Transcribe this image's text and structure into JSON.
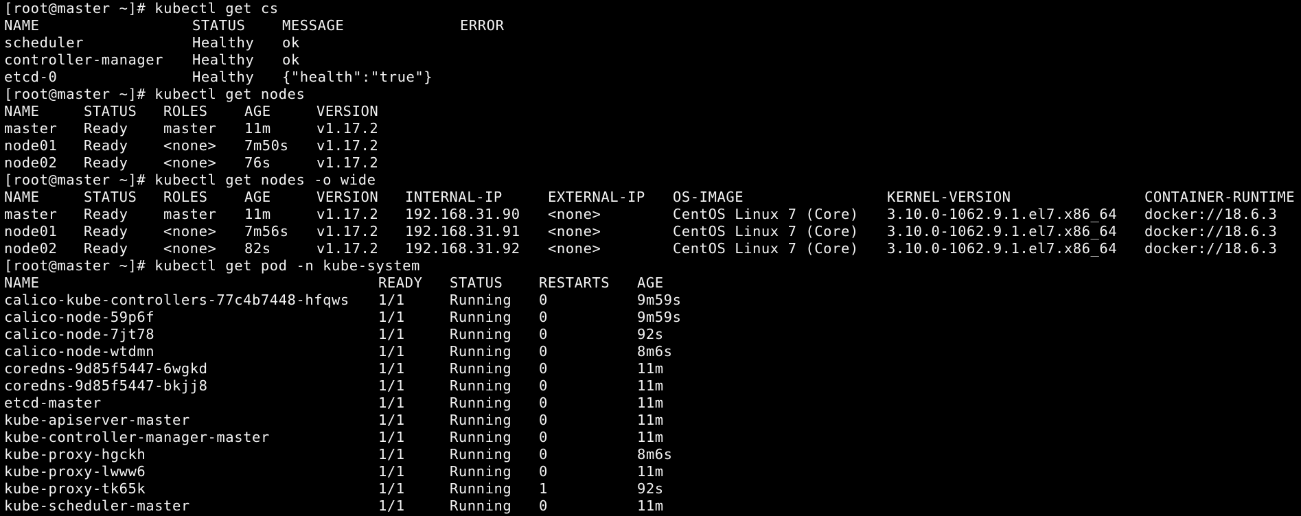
{
  "terminal": {
    "prompt": "[root@master ~]# ",
    "sections": [
      {
        "command": "kubectl get cs",
        "headers": [
          "NAME",
          "STATUS",
          "MESSAGE",
          "ERROR"
        ],
        "rows": [
          [
            "scheduler",
            "Healthy",
            "ok",
            ""
          ],
          [
            "controller-manager",
            "Healthy",
            "ok",
            ""
          ],
          [
            "etcd-0",
            "Healthy",
            "{\"health\":\"true\"}",
            ""
          ]
        ]
      },
      {
        "command": "kubectl get nodes",
        "headers": [
          "NAME",
          "STATUS",
          "ROLES",
          "AGE",
          "VERSION"
        ],
        "rows": [
          [
            "master",
            "Ready",
            "master",
            "11m",
            "v1.17.2"
          ],
          [
            "node01",
            "Ready",
            "<none>",
            "7m50s",
            "v1.17.2"
          ],
          [
            "node02",
            "Ready",
            "<none>",
            "76s",
            "v1.17.2"
          ]
        ]
      },
      {
        "command": "kubectl get nodes -o wide",
        "headers": [
          "NAME",
          "STATUS",
          "ROLES",
          "AGE",
          "VERSION",
          "INTERNAL-IP",
          "EXTERNAL-IP",
          "OS-IMAGE",
          "KERNEL-VERSION",
          "CONTAINER-RUNTIME"
        ],
        "rows": [
          [
            "master",
            "Ready",
            "master",
            "11m",
            "v1.17.2",
            "192.168.31.90",
            "<none>",
            "CentOS Linux 7 (Core)",
            "3.10.0-1062.9.1.el7.x86_64",
            "docker://18.6.3"
          ],
          [
            "node01",
            "Ready",
            "<none>",
            "7m56s",
            "v1.17.2",
            "192.168.31.91",
            "<none>",
            "CentOS Linux 7 (Core)",
            "3.10.0-1062.9.1.el7.x86_64",
            "docker://18.6.3"
          ],
          [
            "node02",
            "Ready",
            "<none>",
            "82s",
            "v1.17.2",
            "192.168.31.92",
            "<none>",
            "CentOS Linux 7 (Core)",
            "3.10.0-1062.9.1.el7.x86_64",
            "docker://18.6.3"
          ]
        ]
      },
      {
        "command": "kubectl get pod -n kube-system",
        "headers": [
          "NAME",
          "READY",
          "STATUS",
          "RESTARTS",
          "AGE"
        ],
        "rows": [
          [
            "calico-kube-controllers-77c4b7448-hfqws",
            "1/1",
            "Running",
            "0",
            "9m59s"
          ],
          [
            "calico-node-59p6f",
            "1/1",
            "Running",
            "0",
            "9m59s"
          ],
          [
            "calico-node-7jt78",
            "1/1",
            "Running",
            "0",
            "92s"
          ],
          [
            "calico-node-wtdmn",
            "1/1",
            "Running",
            "0",
            "8m6s"
          ],
          [
            "coredns-9d85f5447-6wgkd",
            "1/1",
            "Running",
            "0",
            "11m"
          ],
          [
            "coredns-9d85f5447-bkjj8",
            "1/1",
            "Running",
            "0",
            "11m"
          ],
          [
            "etcd-master",
            "1/1",
            "Running",
            "0",
            "11m"
          ],
          [
            "kube-apiserver-master",
            "1/1",
            "Running",
            "0",
            "11m"
          ],
          [
            "kube-controller-manager-master",
            "1/1",
            "Running",
            "0",
            "11m"
          ],
          [
            "kube-proxy-hgckh",
            "1/1",
            "Running",
            "0",
            "8m6s"
          ],
          [
            "kube-proxy-lwww6",
            "1/1",
            "Running",
            "0",
            "11m"
          ],
          [
            "kube-proxy-tk65k",
            "1/1",
            "Running",
            "1",
            "92s"
          ],
          [
            "kube-scheduler-master",
            "1/1",
            "Running",
            "0",
            "11m"
          ]
        ]
      }
    ]
  }
}
